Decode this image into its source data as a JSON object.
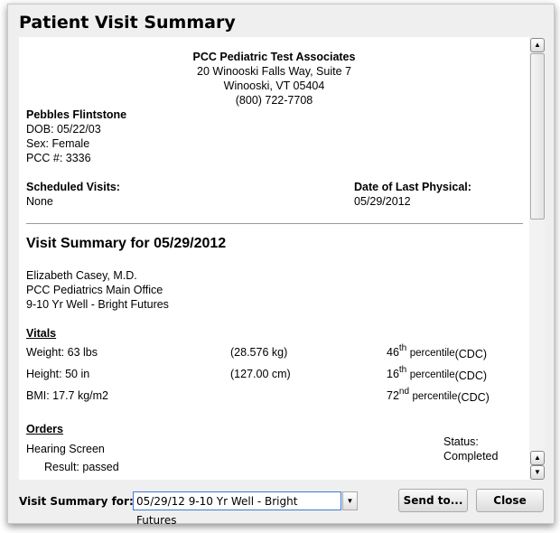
{
  "dialog": {
    "title": "Patient Visit Summary"
  },
  "practice": {
    "name": "PCC Pediatric Test Associates",
    "address1": "20 Winooski Falls Way, Suite 7",
    "address2": "Winooski, VT 05404",
    "phone": "(800) 722-7708"
  },
  "patient": {
    "name": "Pebbles Flintstone",
    "dob": "DOB: 05/22/03",
    "sex": "Sex: Female",
    "pcc": "PCC #: 3336"
  },
  "scheduled": {
    "label": "Scheduled Visits:",
    "value": "None"
  },
  "last_physical": {
    "label": "Date of Last Physical:",
    "value": "05/29/2012"
  },
  "visit": {
    "heading": "Visit Summary for 05/29/2012",
    "provider": "Elizabeth Casey, M.D.",
    "location": "PCC Pediatrics Main Office",
    "visit_type": "9-10 Yr Well - Bright Futures"
  },
  "vitals": {
    "heading": "Vitals",
    "rows": [
      {
        "label": "Weight: 63 lbs",
        "metric": "(28.576 kg)",
        "pct": "46",
        "suffix": "th",
        "pct_label": "percentile",
        "source": "(CDC)"
      },
      {
        "label": "Height: 50 in",
        "metric": "(127.00 cm)",
        "pct": "16",
        "suffix": "th",
        "pct_label": "percentile",
        "source": "(CDC)"
      },
      {
        "label": "BMI: 17.7 kg/m2",
        "metric": "",
        "pct": "72",
        "suffix": "nd",
        "pct_label": "percentile",
        "source": "(CDC)"
      }
    ]
  },
  "orders": {
    "heading": "Orders",
    "item": "Hearing Screen",
    "result": "Result: passed",
    "status_label": "Status:",
    "status": "Completed"
  },
  "footer": {
    "label": "Visit Summary for:",
    "selected": "05/29/12 9-10 Yr Well - Bright Futures",
    "send": "Send to...",
    "close": "Close"
  }
}
